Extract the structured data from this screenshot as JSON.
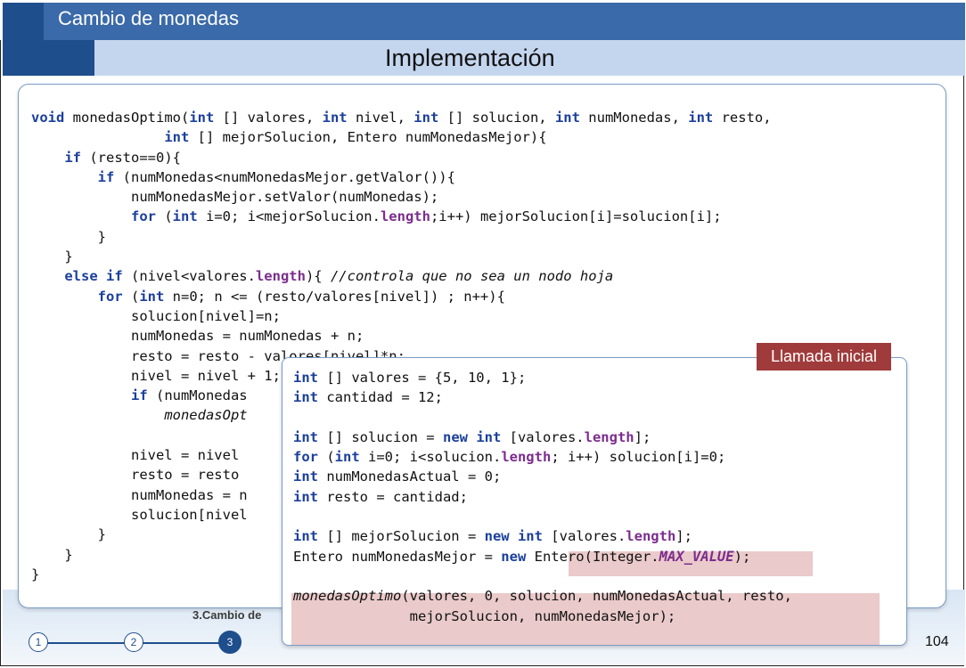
{
  "header": {
    "section_title": "Cambio de monedas",
    "slide_title": "Implementación"
  },
  "main_code": {
    "lines": [
      [
        [
          "kw",
          "void"
        ],
        [
          "",
          "monedasOptimo("
        ],
        [
          "kw",
          "int"
        ],
        [
          "",
          "[] valores, "
        ],
        [
          "kw",
          "int"
        ],
        [
          "",
          "nivel, "
        ],
        [
          "kw",
          "int"
        ],
        [
          "",
          "[] solucion, "
        ],
        [
          "kw",
          "int"
        ],
        [
          "",
          "numMonedas, "
        ],
        [
          "kw",
          "int"
        ],
        [
          "",
          "resto,"
        ]
      ],
      [
        [
          "",
          "                "
        ],
        [
          "kw",
          "int"
        ],
        [
          "",
          "[] mejorSolucion, Entero numMonedasMejor){"
        ]
      ],
      [
        [
          "",
          "    "
        ],
        [
          "kw",
          "if"
        ],
        [
          "",
          "(resto==0){"
        ]
      ],
      [
        [
          "",
          "        "
        ],
        [
          "kw",
          "if"
        ],
        [
          "",
          "(numMonedas<numMonedasMejor.getValor()){"
        ]
      ],
      [
        [
          "",
          "            numMonedasMejor.setValor(numMonedas);"
        ]
      ],
      [
        [
          "",
          "            "
        ],
        [
          "kw",
          "for"
        ],
        [
          "",
          "("
        ],
        [
          "kw",
          "int"
        ],
        [
          "",
          "i=0; i<mejorSolucion."
        ],
        [
          "pk",
          "length"
        ],
        [
          "",
          ";i++) mejorSolucion[i]=solucion[i];"
        ]
      ],
      [
        [
          "",
          "        }"
        ]
      ],
      [
        [
          "",
          "    }"
        ]
      ],
      [
        [
          "",
          "    "
        ],
        [
          "kw",
          "else if"
        ],
        [
          "",
          "(nivel<valores."
        ],
        [
          "pk",
          "length"
        ],
        [
          "",
          "){ "
        ],
        [
          "cm",
          "//controla que no sea un nodo hoja"
        ]
      ],
      [
        [
          "",
          "        "
        ],
        [
          "kw",
          "for"
        ],
        [
          "",
          "("
        ],
        [
          "kw",
          "int"
        ],
        [
          "",
          "n=0; n <= (resto/valores[nivel]) ; n++){"
        ]
      ],
      [
        [
          "",
          "            solucion[nivel]=n;"
        ]
      ],
      [
        [
          "",
          "            numMonedas = numMonedas + n;"
        ]
      ],
      [
        [
          "",
          "            resto = resto - valores[nivel]*n;"
        ]
      ],
      [
        [
          "",
          "            nivel = nivel + 1;"
        ]
      ],
      [
        [
          "",
          "            "
        ],
        [
          "kw",
          "if"
        ],
        [
          "",
          "(numMonedas"
        ]
      ],
      [
        [
          "",
          "                "
        ],
        [
          "it",
          "monedasOpt"
        ]
      ],
      [
        [
          "",
          ""
        ]
      ],
      [
        [
          "",
          "            nivel = nivel"
        ]
      ],
      [
        [
          "",
          "            resto = resto"
        ]
      ],
      [
        [
          "",
          "            numMonedas = n"
        ]
      ],
      [
        [
          "",
          "            solucion[nivel"
        ]
      ],
      [
        [
          "",
          "        }"
        ]
      ],
      [
        [
          "",
          "    }"
        ]
      ],
      [
        [
          "",
          "}"
        ]
      ]
    ]
  },
  "popup": {
    "tag": "Llamada inicial",
    "lines": [
      [
        [
          "kw",
          "int"
        ],
        [
          "",
          "[] valores = {5, 10, 1};"
        ]
      ],
      [
        [
          "kw",
          "int"
        ],
        [
          "",
          "cantidad = 12;"
        ]
      ],
      [
        [
          "",
          ""
        ]
      ],
      [
        [
          "kw",
          "int"
        ],
        [
          "",
          "[] solucion = "
        ],
        [
          "kw",
          "new"
        ],
        [
          "",
          ""
        ],
        [
          "kw",
          "int"
        ],
        [
          "",
          "[valores."
        ],
        [
          "pk",
          "length"
        ],
        [
          "",
          "];"
        ]
      ],
      [
        [
          "kw",
          "for"
        ],
        [
          "",
          "("
        ],
        [
          "kw",
          "int"
        ],
        [
          "",
          "i=0; i<solucion."
        ],
        [
          "pk",
          "length"
        ],
        [
          "",
          "; i++) solucion[i]=0;"
        ]
      ],
      [
        [
          "kw",
          "int"
        ],
        [
          "",
          "numMonedasActual = 0;"
        ]
      ],
      [
        [
          "kw",
          "int"
        ],
        [
          "",
          "resto = cantidad;"
        ]
      ],
      [
        [
          "",
          ""
        ]
      ],
      [
        [
          "kw",
          "int"
        ],
        [
          "",
          "[] mejorSolucion = "
        ],
        [
          "kw",
          "new"
        ],
        [
          "",
          ""
        ],
        [
          "kw",
          "int"
        ],
        [
          "",
          "[valores."
        ],
        [
          "pk",
          "length"
        ],
        [
          "",
          "];"
        ]
      ],
      [
        [
          "",
          "Entero numMonedasMejor = "
        ],
        [
          "kw",
          "new"
        ],
        [
          "",
          "Entero(Integer."
        ],
        [
          "pk it",
          "MAX_VALUE"
        ],
        [
          "",
          ");"
        ]
      ],
      [
        [
          "",
          ""
        ]
      ],
      [
        [
          "it",
          "monedasOptimo"
        ],
        [
          "",
          "(valores, 0, solucion, numMonedasActual, resto,"
        ]
      ],
      [
        [
          "",
          "              mejorSolucion, numMonedasMejor);"
        ]
      ]
    ]
  },
  "footer": {
    "section_label": "3.Cambio de",
    "steps": [
      "1",
      "2",
      "3"
    ],
    "active_step": 3,
    "page_number": "104"
  },
  "colors": {
    "keyword": "#1b3f9c",
    "property": "#7b2d8e",
    "header_dark": "#1f4e8c",
    "header_light": "#c4d6ee",
    "tag": "#a03b3b",
    "highlight": "#eacaca"
  }
}
